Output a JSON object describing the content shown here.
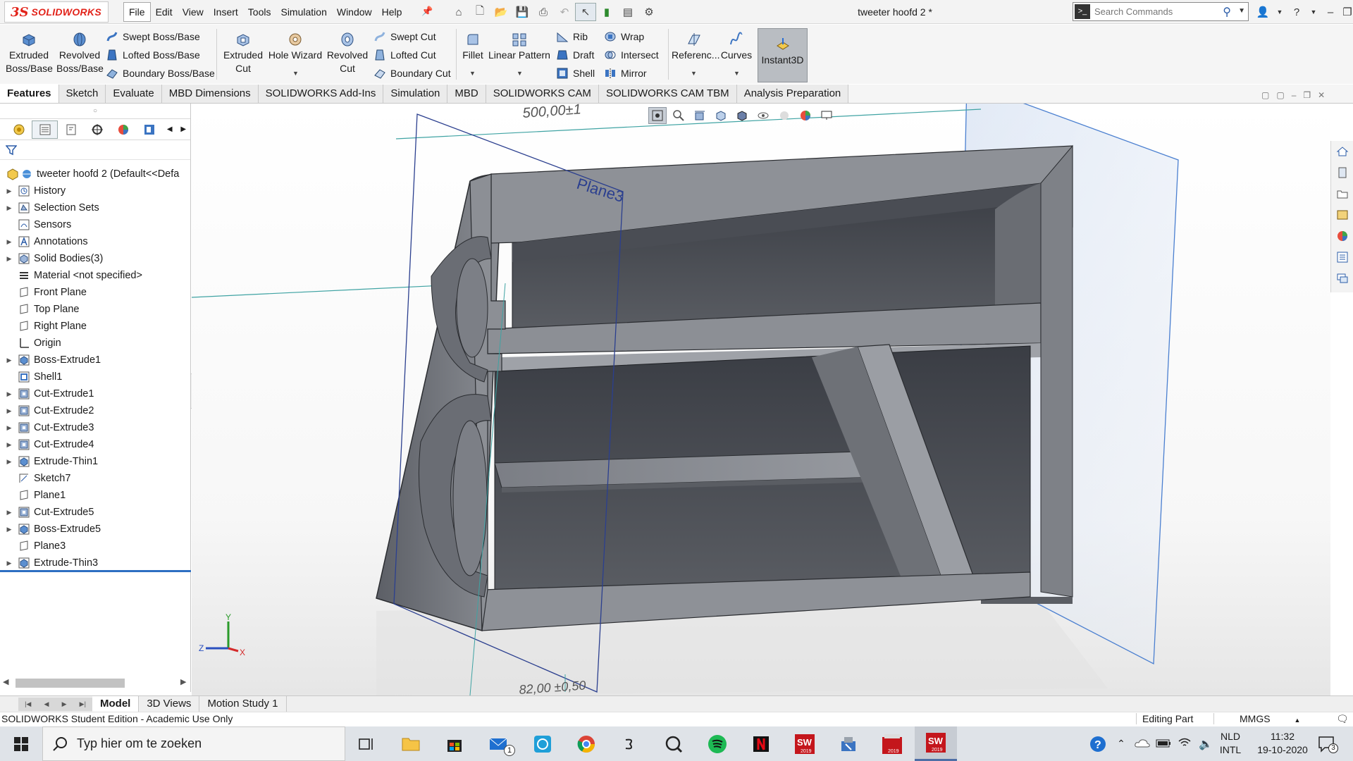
{
  "app": {
    "brand": "SOLIDWORKS",
    "brand_mark": "3S",
    "document_title": "tweeter hoofd 2 *",
    "colors": {
      "brand": "#e2231a",
      "selection": "#2d6fc2",
      "part": "#7d8087"
    }
  },
  "menubar": {
    "items": [
      {
        "id": "file",
        "label": "File",
        "active": true
      },
      {
        "id": "edit",
        "label": "Edit"
      },
      {
        "id": "view",
        "label": "View"
      },
      {
        "id": "insert",
        "label": "Insert"
      },
      {
        "id": "tools",
        "label": "Tools"
      },
      {
        "id": "simulation",
        "label": "Simulation"
      },
      {
        "id": "window",
        "label": "Window"
      },
      {
        "id": "help",
        "label": "Help"
      }
    ]
  },
  "search": {
    "placeholder": "Search Commands"
  },
  "ribbon": {
    "extruded_boss": [
      "Extruded",
      "Boss/Base"
    ],
    "revolved_boss": [
      "Revolved",
      "Boss/Base"
    ],
    "swept_boss": "Swept Boss/Base",
    "lofted_boss": "Lofted Boss/Base",
    "boundary_boss": "Boundary Boss/Base",
    "extruded_cut": [
      "Extruded",
      "Cut"
    ],
    "hole_wizard": "Hole Wizard",
    "revolved_cut": [
      "Revolved",
      "Cut"
    ],
    "swept_cut": "Swept Cut",
    "lofted_cut": "Lofted Cut",
    "boundary_cut": "Boundary Cut",
    "fillet": "Fillet",
    "linear_pattern": "Linear Pattern",
    "rib": "Rib",
    "draft": "Draft",
    "shell": "Shell",
    "wrap": "Wrap",
    "intersect": "Intersect",
    "mirror": "Mirror",
    "reference": "Referenc...",
    "curves": "Curves",
    "instant3d": "Instant3D"
  },
  "command_tabs": [
    {
      "id": "features",
      "label": "Features",
      "active": true
    },
    {
      "id": "sketch",
      "label": "Sketch"
    },
    {
      "id": "evaluate",
      "label": "Evaluate"
    },
    {
      "id": "mbd-dimensions",
      "label": "MBD Dimensions"
    },
    {
      "id": "addins",
      "label": "SOLIDWORKS Add-Ins"
    },
    {
      "id": "simulation",
      "label": "Simulation"
    },
    {
      "id": "mbd",
      "label": "MBD"
    },
    {
      "id": "cam",
      "label": "SOLIDWORKS CAM"
    },
    {
      "id": "cam-tbm",
      "label": "SOLIDWORKS CAM TBM"
    },
    {
      "id": "analysis",
      "label": "Analysis Preparation"
    }
  ],
  "feature_tree": {
    "root": "tweeter hoofd 2  (Default<<Defa",
    "items": [
      {
        "label": "History",
        "icon": "history-icon",
        "expand": true
      },
      {
        "label": "Selection Sets",
        "icon": "selection-sets-icon",
        "expand": true
      },
      {
        "label": "Sensors",
        "icon": "sensors-icon",
        "expand": false
      },
      {
        "label": "Annotations",
        "icon": "annotations-icon",
        "expand": true
      },
      {
        "label": "Solid Bodies(3)",
        "icon": "solid-bodies-icon",
        "expand": true
      },
      {
        "label": "Material <not specified>",
        "icon": "material-icon",
        "expand": false
      },
      {
        "label": "Front Plane",
        "icon": "plane-icon",
        "expand": false
      },
      {
        "label": "Top Plane",
        "icon": "plane-icon",
        "expand": false
      },
      {
        "label": "Right Plane",
        "icon": "plane-icon",
        "expand": false
      },
      {
        "label": "Origin",
        "icon": "origin-icon",
        "expand": false
      },
      {
        "label": "Boss-Extrude1",
        "icon": "extrude-feature-icon",
        "expand": true
      },
      {
        "label": "Shell1",
        "icon": "shell-feature-icon",
        "expand": false
      },
      {
        "label": "Cut-Extrude1",
        "icon": "cut-feature-icon",
        "expand": true
      },
      {
        "label": "Cut-Extrude2",
        "icon": "cut-feature-icon",
        "expand": true
      },
      {
        "label": "Cut-Extrude3",
        "icon": "cut-feature-icon",
        "expand": true
      },
      {
        "label": "Cut-Extrude4",
        "icon": "cut-feature-icon",
        "expand": true
      },
      {
        "label": "Extrude-Thin1",
        "icon": "extrude-feature-icon",
        "expand": true
      },
      {
        "label": "Sketch7",
        "icon": "sketch-icon",
        "expand": false
      },
      {
        "label": "Plane1",
        "icon": "plane-icon",
        "expand": false
      },
      {
        "label": "Cut-Extrude5",
        "icon": "cut-feature-icon",
        "expand": true
      },
      {
        "label": "Boss-Extrude5",
        "icon": "extrude-feature-icon",
        "expand": true
      },
      {
        "label": "Plane3",
        "icon": "plane-icon",
        "expand": false
      },
      {
        "label": "Extrude-Thin3",
        "icon": "extrude-feature-icon",
        "expand": true
      }
    ]
  },
  "viewport": {
    "plane_label": "Plane3",
    "dimension_top": "500,00±1",
    "dimension_bottom": "82,00 ±0,50",
    "axis_labels": {
      "x": "X",
      "y": "Y",
      "z": "Z"
    }
  },
  "bottom_tabs": [
    {
      "id": "model",
      "label": "Model",
      "active": true
    },
    {
      "id": "3dviews",
      "label": "3D Views"
    },
    {
      "id": "motion",
      "label": "Motion Study 1"
    }
  ],
  "status": {
    "edition": "SOLIDWORKS Student Edition - Academic Use Only",
    "mode": "Editing Part",
    "units": "MMGS"
  },
  "taskbar": {
    "search_placeholder": "Typ hier om te zoeken",
    "mail_badge": "1",
    "lang_line1": "NLD",
    "lang_line2": "INTL",
    "time": "11:32",
    "date": "19-10-2020",
    "notifications": "3",
    "sw_year": "2019"
  }
}
